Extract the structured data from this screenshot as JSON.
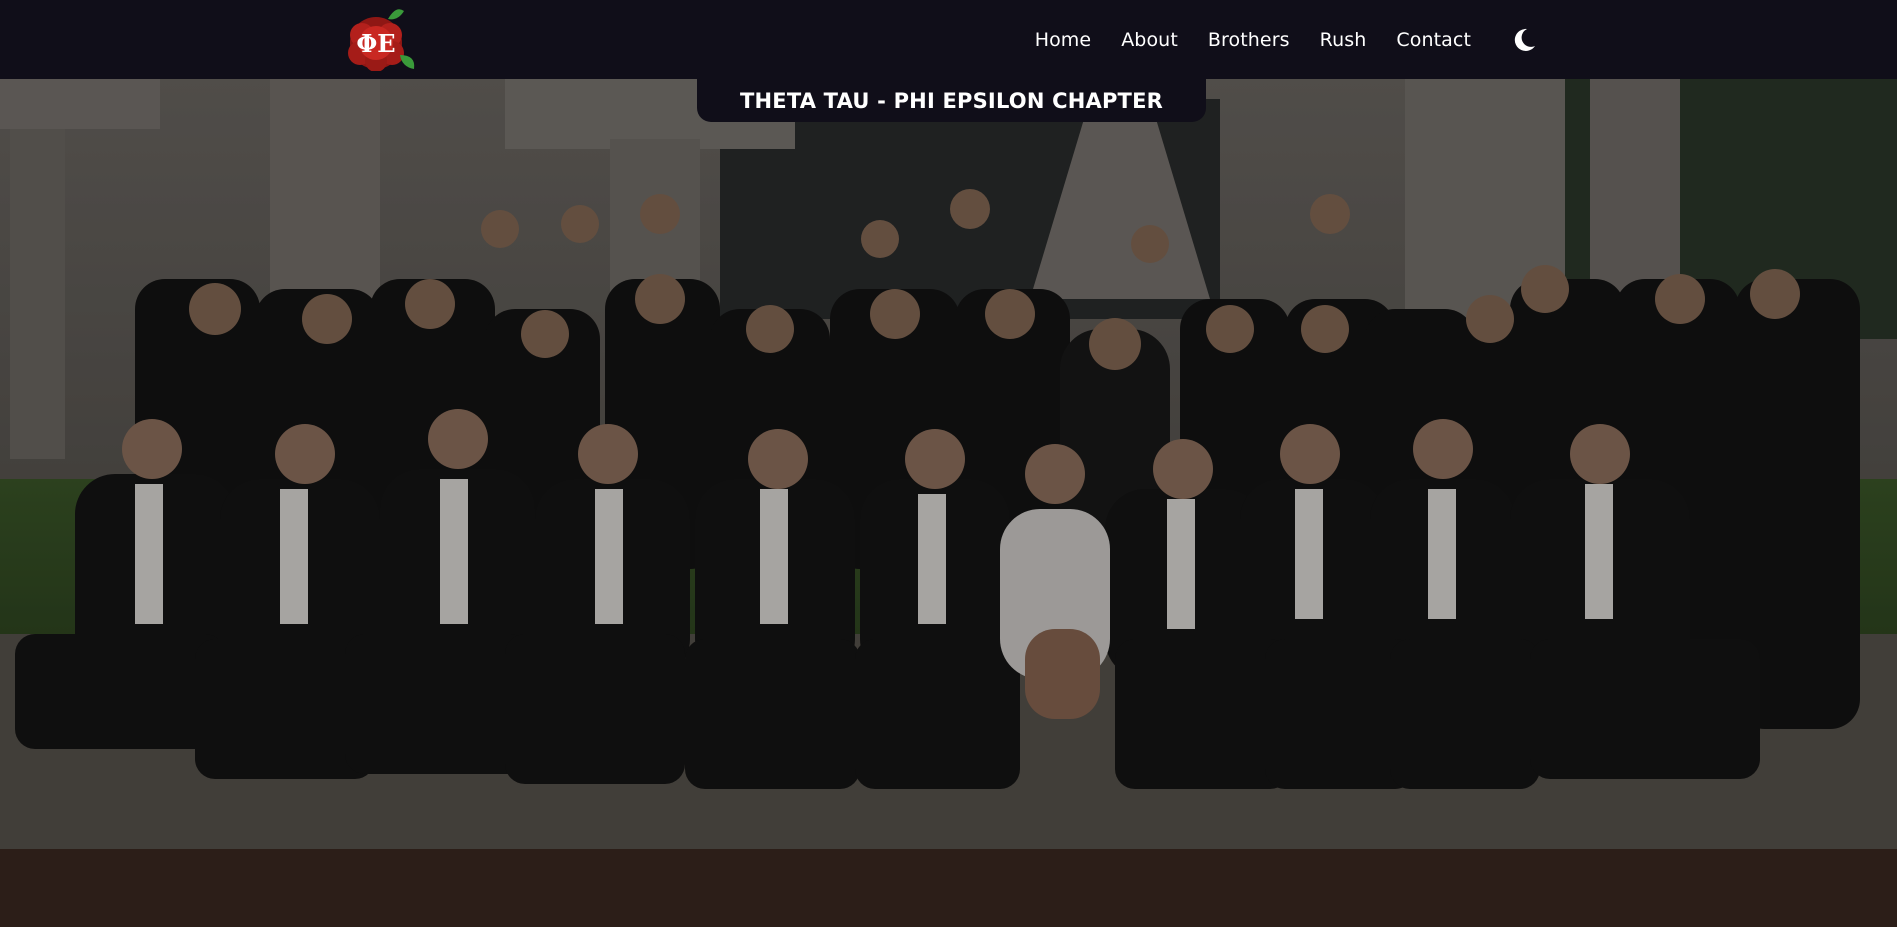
{
  "nav": {
    "logo_alt": "ΦΕ",
    "links": [
      {
        "label": "Home"
      },
      {
        "label": "About"
      },
      {
        "label": "Brothers"
      },
      {
        "label": "Rush"
      },
      {
        "label": "Contact"
      }
    ],
    "theme_icon": "moon-icon"
  },
  "hero": {
    "title": "THETA TAU - PHI EPSILON CHAPTER",
    "photo": "group-photo"
  },
  "colors": {
    "navbar_bg": "#100e19",
    "text": "#ffffff",
    "logo_red": "#b3201c",
    "logo_green": "#3a9a3a"
  }
}
